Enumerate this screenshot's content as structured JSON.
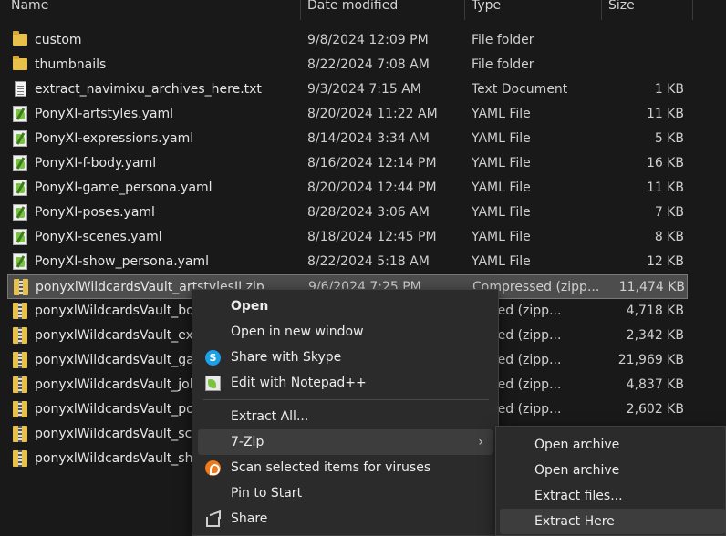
{
  "columns": {
    "name": "Name",
    "date": "Date modified",
    "type": "Type",
    "size": "Size"
  },
  "files": [
    {
      "name": "custom",
      "date": "9/8/2024 12:09 PM",
      "type": "File folder",
      "size": "",
      "icon": "folder-icon"
    },
    {
      "name": "thumbnails",
      "date": "8/22/2024 7:08 AM",
      "type": "File folder",
      "size": "",
      "icon": "folder-icon"
    },
    {
      "name": "extract_navimixu_archives_here.txt",
      "date": "9/3/2024 7:15 AM",
      "type": "Text Document",
      "size": "1 KB",
      "icon": "text-file-icon"
    },
    {
      "name": "PonyXI-artstyles.yaml",
      "date": "8/20/2024 11:22 AM",
      "type": "YAML File",
      "size": "11 KB",
      "icon": "yaml-file-icon"
    },
    {
      "name": "PonyXI-expressions.yaml",
      "date": "8/14/2024 3:34 AM",
      "type": "YAML File",
      "size": "5 KB",
      "icon": "yaml-file-icon"
    },
    {
      "name": "PonyXI-f-body.yaml",
      "date": "8/16/2024 12:14 PM",
      "type": "YAML File",
      "size": "16 KB",
      "icon": "yaml-file-icon"
    },
    {
      "name": "PonyXI-game_persona.yaml",
      "date": "8/20/2024 12:44 PM",
      "type": "YAML File",
      "size": "11 KB",
      "icon": "yaml-file-icon"
    },
    {
      "name": "PonyXI-poses.yaml",
      "date": "8/28/2024 3:06 AM",
      "type": "YAML File",
      "size": "7 KB",
      "icon": "yaml-file-icon"
    },
    {
      "name": "PonyXI-scenes.yaml",
      "date": "8/18/2024 12:45 PM",
      "type": "YAML File",
      "size": "8 KB",
      "icon": "yaml-file-icon"
    },
    {
      "name": "PonyXI-show_persona.yaml",
      "date": "8/22/2024 5:18 AM",
      "type": "YAML File",
      "size": "12 KB",
      "icon": "yaml-file-icon"
    },
    {
      "name": "ponyxlWildcardsVault_artstylesII.zip",
      "date": "9/6/2024 7:25 PM",
      "type": "Compressed (zipp...",
      "size": "11,474 KB",
      "icon": "zip-file-icon",
      "selected": true
    },
    {
      "name": "ponyxlWildcardsVault_bod",
      "date": "",
      "type": "ressed (zipp...",
      "size": "4,718 KB",
      "icon": "zip-file-icon"
    },
    {
      "name": "ponyxlWildcardsVault_exp",
      "date": "",
      "type": "ressed (zipp...",
      "size": "2,342 KB",
      "icon": "zip-file-icon"
    },
    {
      "name": "ponyxlWildcardsVault_gan",
      "date": "",
      "type": "ressed (zipp...",
      "size": "21,969 KB",
      "icon": "zip-file-icon"
    },
    {
      "name": "ponyxlWildcardsVault_job",
      "date": "",
      "type": "ressed (zipp...",
      "size": "4,837 KB",
      "icon": "zip-file-icon"
    },
    {
      "name": "ponyxlWildcardsVault_pos",
      "date": "",
      "type": "ressed (zipp...",
      "size": "2,602 KB",
      "icon": "zip-file-icon"
    },
    {
      "name": "ponyxlWildcardsVault_scen",
      "date": "",
      "type": "",
      "size": "",
      "icon": "zip-file-icon"
    },
    {
      "name": "ponyxlWildcardsVault_sho",
      "date": "",
      "type": "",
      "size": "",
      "icon": "zip-file-icon"
    }
  ],
  "context_menu": {
    "open": "Open",
    "open_new_window": "Open in new window",
    "share_skype": "Share with Skype",
    "edit_notepad": "Edit with Notepad++",
    "extract_all": "Extract All...",
    "seven_zip": "7-Zip",
    "scan_viruses": "Scan selected items for viruses",
    "pin_start": "Pin to Start",
    "share": "Share",
    "submenu_arrow": "›"
  },
  "submenu": {
    "open_archive_1": "Open archive",
    "open_archive_2": "Open archive",
    "extract_files": "Extract files...",
    "extract_here": "Extract Here"
  },
  "icons": {
    "skype_glyph": "S"
  },
  "colors": {
    "background": "#191919",
    "menu_bg": "#2b2b2b",
    "selection": "#4d4d4d",
    "folder": "#e8c14b",
    "skype": "#1ea0e8",
    "avast": "#f07a1a"
  }
}
